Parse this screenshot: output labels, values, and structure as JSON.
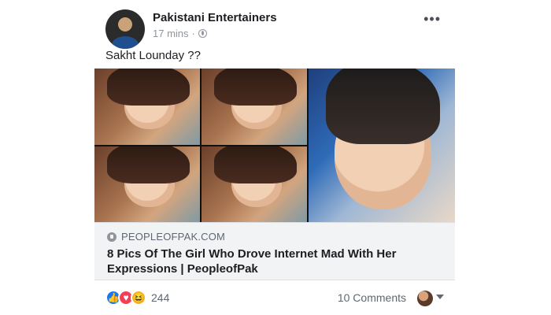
{
  "post": {
    "author": "Pakistani Entertainers",
    "time": "17 mins",
    "separator": "·",
    "caption": "Sakht Lounday ??",
    "more_label": "•••"
  },
  "link_preview": {
    "domain": "PEOPLEOFPAK.COM",
    "title": "8 Pics Of The Girl Who Drove Internet Mad With Her Expressions | PeopleofPak"
  },
  "engagement": {
    "reaction_count": "244",
    "comments_label": "10 Comments"
  },
  "icons": {
    "reactions": [
      "like-icon",
      "love-icon",
      "haha-icon"
    ],
    "privacy": "globe-icon",
    "options": "more-options-icon"
  }
}
